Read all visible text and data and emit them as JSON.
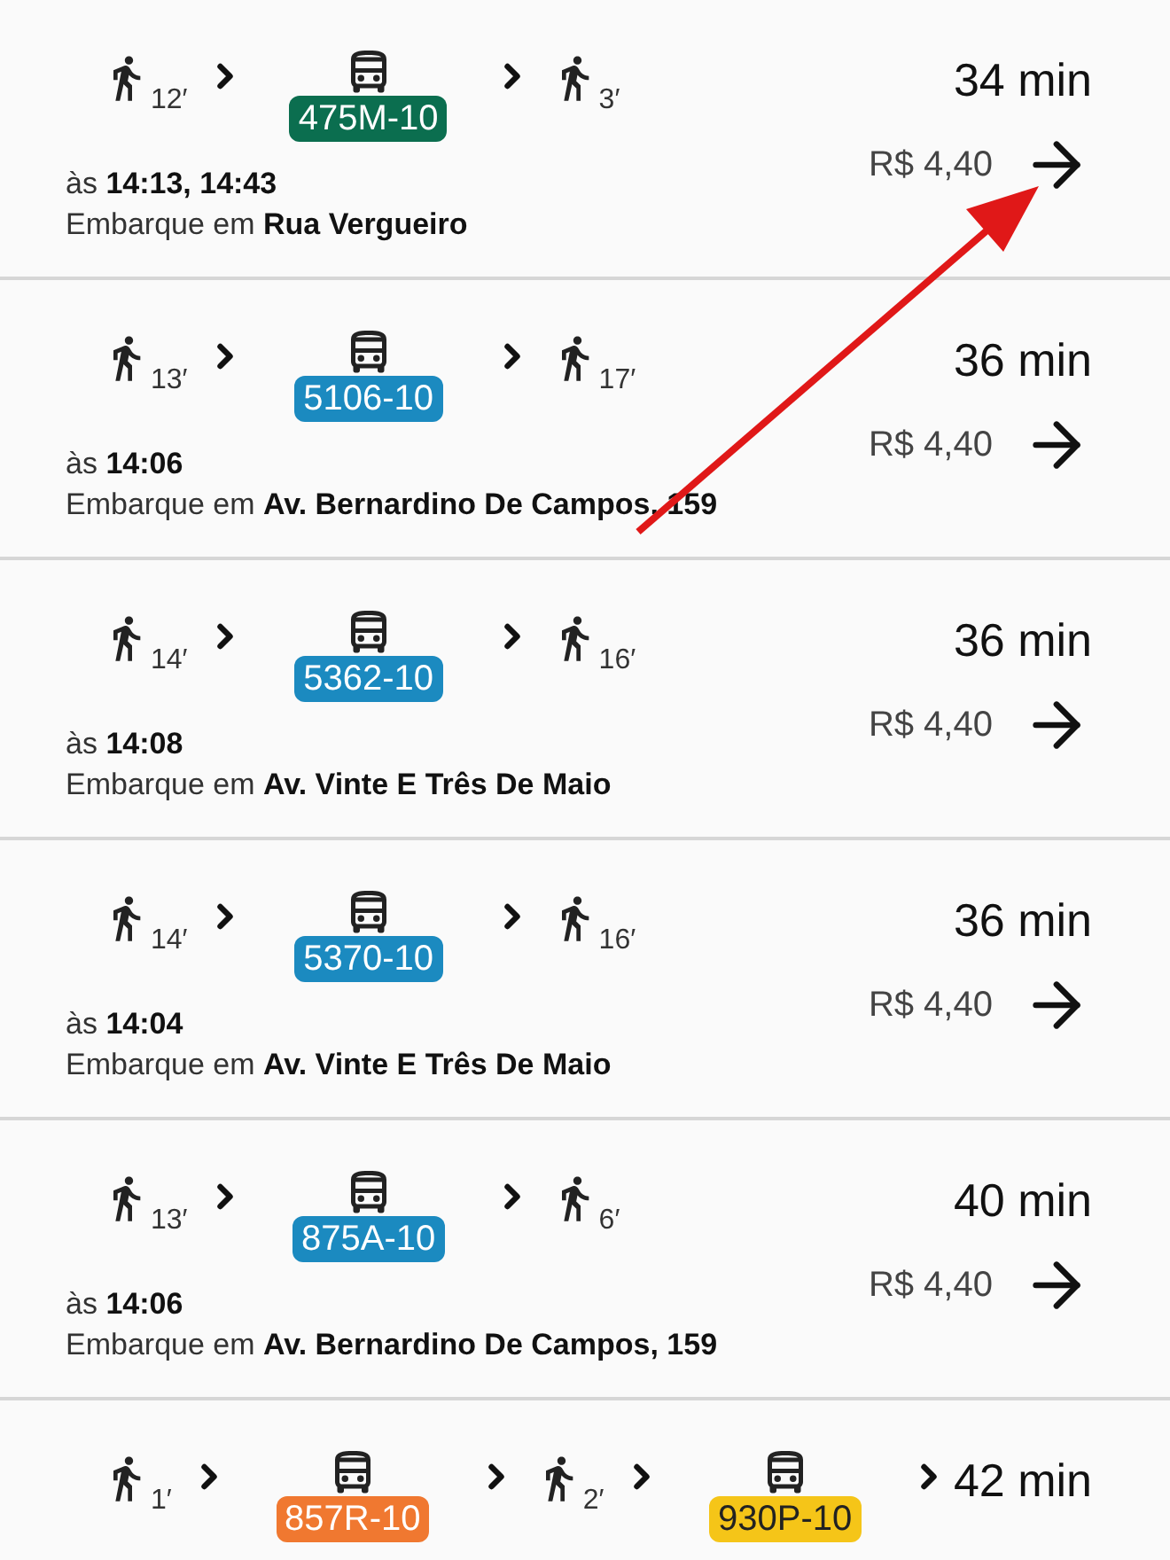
{
  "routes": [
    {
      "legs": [
        {
          "kind": "walk",
          "minutes": "12′"
        },
        {
          "kind": "bus",
          "line": "475M-10",
          "color": "#0b6e4f"
        },
        {
          "kind": "walk",
          "minutes": "3′"
        }
      ],
      "departure": "às **14:13, 14:43**",
      "boarding": "Embarque em **Rua Vergueiro**",
      "duration": "34 min",
      "price": "R$ 4,40"
    },
    {
      "legs": [
        {
          "kind": "walk",
          "minutes": "13′"
        },
        {
          "kind": "bus",
          "line": "5106-10",
          "color": "#1b8ac0"
        },
        {
          "kind": "walk",
          "minutes": "17′"
        }
      ],
      "departure": "às **14:06**",
      "boarding": "Embarque em **Av. Bernardino De Campos, 159**",
      "duration": "36 min",
      "price": "R$ 4,40"
    },
    {
      "legs": [
        {
          "kind": "walk",
          "minutes": "14′"
        },
        {
          "kind": "bus",
          "line": "5362-10",
          "color": "#1b8ac0"
        },
        {
          "kind": "walk",
          "minutes": "16′"
        }
      ],
      "departure": "às **14:08**",
      "boarding": "Embarque em **Av. Vinte E Três De Maio**",
      "duration": "36 min",
      "price": "R$ 4,40"
    },
    {
      "legs": [
        {
          "kind": "walk",
          "minutes": "14′"
        },
        {
          "kind": "bus",
          "line": "5370-10",
          "color": "#1b8ac0"
        },
        {
          "kind": "walk",
          "minutes": "16′"
        }
      ],
      "departure": "às **14:04**",
      "boarding": "Embarque em **Av. Vinte E Três De Maio**",
      "duration": "36 min",
      "price": "R$ 4,40"
    },
    {
      "legs": [
        {
          "kind": "walk",
          "minutes": "13′"
        },
        {
          "kind": "bus",
          "line": "875A-10",
          "color": "#1b8ac0"
        },
        {
          "kind": "walk",
          "minutes": "6′"
        }
      ],
      "departure": "às **14:06**",
      "boarding": "Embarque em **Av. Bernardino De Campos, 159**",
      "duration": "40 min",
      "price": "R$ 4,40"
    },
    {
      "legs": [
        {
          "kind": "walk",
          "minutes": "1′"
        },
        {
          "kind": "bus",
          "line": "857R-10",
          "color": "#f07830"
        },
        {
          "kind": "walk",
          "minutes": "2′"
        },
        {
          "kind": "bus",
          "line": "930P-10",
          "color": "#f5c518"
        }
      ],
      "duration": "42 min"
    }
  ]
}
